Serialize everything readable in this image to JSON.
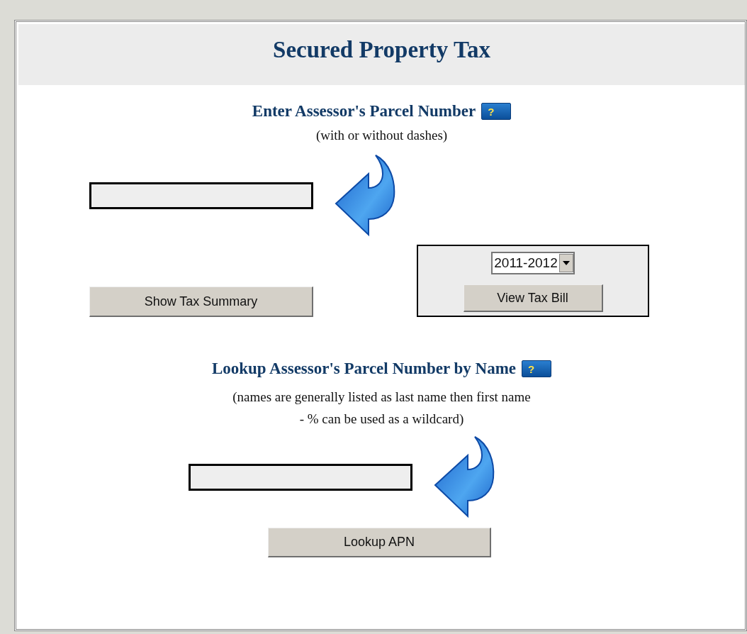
{
  "title": "Secured Property Tax",
  "apn_section": {
    "heading": "Enter Assessor's Parcel Number",
    "help_glyph": "?",
    "note": "(with or without dashes)",
    "year_select": {
      "value": "2011-2012"
    },
    "buttons": [
      "Show Tax Summary",
      "View Tax Bill"
    ]
  },
  "name_section": {
    "heading": "Lookup Assessor's Parcel Number by Name",
    "help_glyph": "?",
    "note_lines": [
      "(names are generally listed as last name then first name",
      "- % can be used as a wildcard)"
    ],
    "button": "Lookup APN"
  }
}
